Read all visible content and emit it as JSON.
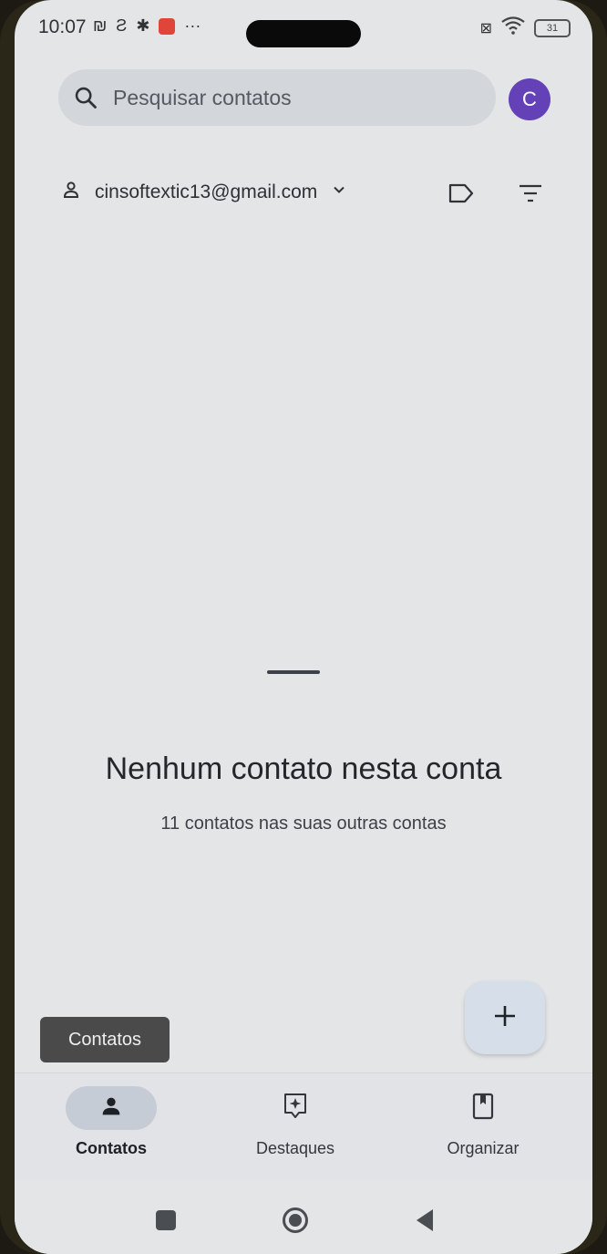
{
  "status_bar": {
    "time": "10:07",
    "battery": "31",
    "left_icons": [
      "nfc-icon",
      "s-icon",
      "settings-icon",
      "mail-icon",
      "more-icon"
    ],
    "right_icons": [
      "no-sim-icon",
      "wifi-icon",
      "battery-icon"
    ]
  },
  "search": {
    "placeholder": "Pesquisar contatos"
  },
  "avatar": {
    "initial": "C",
    "color": "#6541b8"
  },
  "account": {
    "email": "cinsoftextic13@gmail.com"
  },
  "empty_state": {
    "title": "Nenhum contato nesta conta",
    "subtitle": "11 contatos nas suas outras contas"
  },
  "tooltip": {
    "label": "Contatos"
  },
  "bottom_nav": {
    "items": [
      {
        "label": "Contatos",
        "icon": "person-icon",
        "active": true
      },
      {
        "label": "Destaques",
        "icon": "highlights-icon",
        "active": false
      },
      {
        "label": "Organizar",
        "icon": "bookmark-icon",
        "active": false
      }
    ]
  },
  "colors": {
    "background": "#e3e5e7",
    "search_bar": "#d3d6da",
    "active_nav_pill": "#c6ccd6",
    "fab": "#d6dee9"
  }
}
